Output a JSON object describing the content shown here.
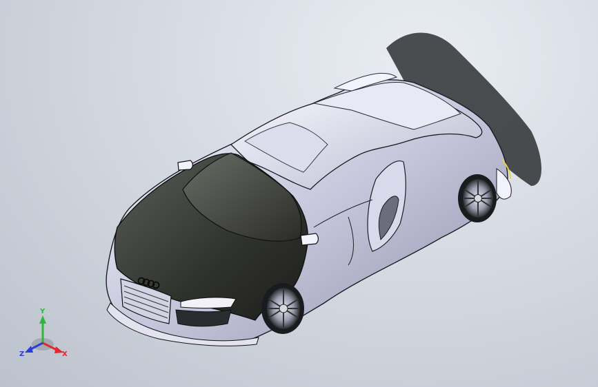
{
  "viewport": {
    "model": "car-3d-model",
    "background_top": "#e9edf3",
    "background_bottom": "#bcc2cc",
    "body_color": "#c9cbe0",
    "hood_color": "#3c3f3a"
  },
  "triad": {
    "x_label": "X",
    "y_label": "Y",
    "z_label": "Z",
    "x_color": "#e0282d",
    "y_color": "#2fb73c",
    "z_color": "#2a3fd8"
  }
}
